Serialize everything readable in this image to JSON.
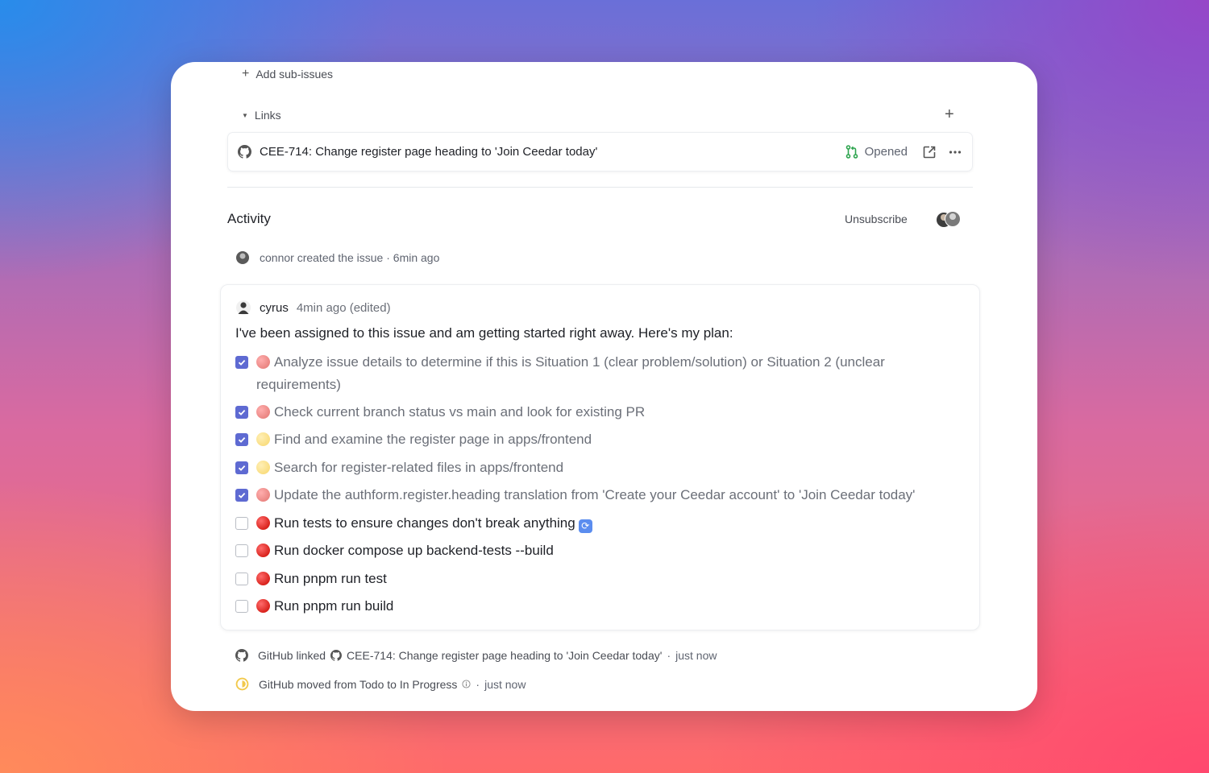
{
  "sub_issues": {
    "add_label": "Add sub-issues"
  },
  "links": {
    "section_label": "Links",
    "item": {
      "title": "CEE-714: Change register page heading to 'Join Ceedar today'",
      "status": "Opened"
    }
  },
  "activity": {
    "title": "Activity",
    "unsubscribe_label": "Unsubscribe",
    "created_event": {
      "text": "connor created the issue",
      "time": "6min ago"
    },
    "comment": {
      "author": "cyrus",
      "time": "4min ago (edited)",
      "intro": "I've been assigned to this issue and am getting started right away. Here's my plan:",
      "tasks": [
        {
          "text": "Analyze issue details to determine if this is Situation 1 (clear problem/solution) or Situation 2 (unclear requirements)",
          "done": true,
          "dot": "red"
        },
        {
          "text": "Check current branch status vs main and look for existing PR",
          "done": true,
          "dot": "red"
        },
        {
          "text": "Find and examine the register page in apps/frontend",
          "done": true,
          "dot": "yellow"
        },
        {
          "text": "Search for register-related files in apps/frontend",
          "done": true,
          "dot": "yellow"
        },
        {
          "text": "Update the authform.register.heading translation from 'Create your Ceedar account' to 'Join Ceedar today'",
          "done": true,
          "dot": "red"
        },
        {
          "text": "Run tests to ensure changes don't break anything",
          "done": false,
          "dot": "red"
        },
        {
          "text": "Run docker compose up backend-tests --build",
          "done": false,
          "dot": "red"
        },
        {
          "text": "Run pnpm run test",
          "done": false,
          "dot": "red"
        },
        {
          "text": "Run pnpm run build",
          "done": false,
          "dot": "red"
        }
      ]
    },
    "events": [
      {
        "prefix": "GitHub linked",
        "link": "CEE-714: Change register page heading to 'Join Ceedar today'",
        "time": "just now"
      },
      {
        "text": "GitHub moved from Todo to In Progress",
        "time": "just now"
      }
    ]
  },
  "colors": {
    "accent": "#5e6ad2",
    "pr_open": "#2da44e",
    "progress": "#f2c94c"
  }
}
